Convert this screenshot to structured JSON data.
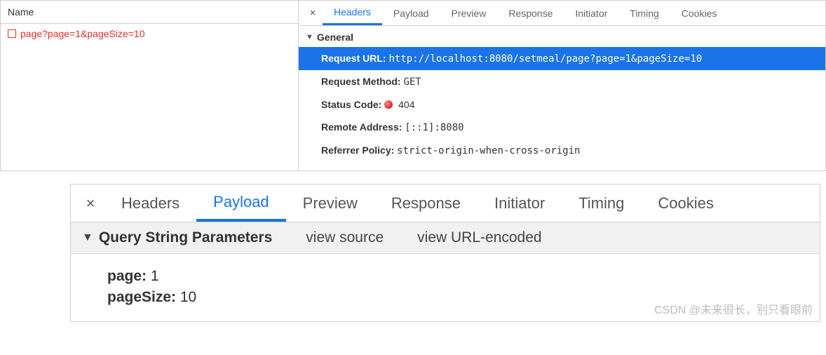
{
  "nameList": {
    "header": "Name",
    "item": "page?page=1&pageSize=10"
  },
  "tabsTop": {
    "close": "×",
    "headers": "Headers",
    "payload": "Payload",
    "preview": "Preview",
    "response": "Response",
    "initiator": "Initiator",
    "timing": "Timing",
    "cookies": "Cookies"
  },
  "general": {
    "section": "General",
    "requestUrl_k": "Request URL:",
    "requestUrl_v": "http://localhost:8080/setmeal/page?page=1&pageSize=10",
    "requestMethod_k": "Request Method:",
    "requestMethod_v": "GET",
    "statusCode_k": "Status Code:",
    "statusCode_v": "404",
    "remoteAddress_k": "Remote Address:",
    "remoteAddress_v": "[::1]:8080",
    "referrerPolicy_k": "Referrer Policy:",
    "referrerPolicy_v": "strict-origin-when-cross-origin"
  },
  "tabsBottom": {
    "close": "×",
    "headers": "Headers",
    "payload": "Payload",
    "preview": "Preview",
    "response": "Response",
    "initiator": "Initiator",
    "timing": "Timing",
    "cookies": "Cookies"
  },
  "query": {
    "section": "Query String Parameters",
    "viewSource": "view source",
    "viewUrlEncoded": "view URL-encoded",
    "params": {
      "page_k": "page:",
      "page_v": "1",
      "pageSize_k": "pageSize:",
      "pageSize_v": "10"
    }
  },
  "watermark": "CSDN @未来很长，别只看眼前"
}
